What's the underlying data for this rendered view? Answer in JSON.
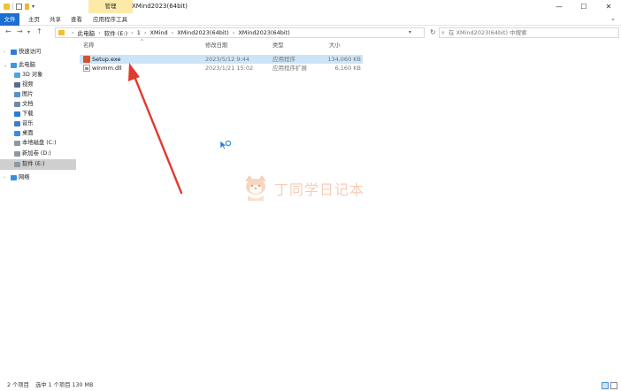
{
  "window": {
    "title": "XMind2023(64bit)",
    "context_tab": "管理",
    "controls": {
      "minimize": "—",
      "maximize": "☐",
      "close": "✕"
    }
  },
  "ribbon": {
    "tabs": [
      "文件",
      "主页",
      "共享",
      "查看",
      "应用程序工具"
    ],
    "collapse_glyph": "⌄"
  },
  "address": {
    "crumbs": [
      "此电脑",
      "软件 (E:)",
      "1",
      "XMind",
      "XMind2023(64bit)",
      "XMind2023(64bit)"
    ],
    "search_placeholder": "在 XMind2023(64bit) 中搜索"
  },
  "sidebar": {
    "items": [
      {
        "label": "快速访问",
        "icon": "star-icon",
        "color": "#2f7cd6"
      },
      {
        "label": "此电脑",
        "icon": "computer-icon",
        "color": "#3a9ad9"
      },
      {
        "label": "3D 对象",
        "icon": "cube-icon",
        "color": "#4aa8e0"
      },
      {
        "label": "视频",
        "icon": "video-icon",
        "color": "#5b6d85"
      },
      {
        "label": "图片",
        "icon": "picture-icon",
        "color": "#5a8fc7"
      },
      {
        "label": "文档",
        "icon": "document-icon",
        "color": "#6d88a8"
      },
      {
        "label": "下载",
        "icon": "download-icon",
        "color": "#2a7bd4"
      },
      {
        "label": "音乐",
        "icon": "music-icon",
        "color": "#3c7fd0"
      },
      {
        "label": "桌面",
        "icon": "desktop-icon",
        "color": "#3a8dde"
      },
      {
        "label": "本地磁盘 (C:)",
        "icon": "drive-icon",
        "color": "#8c98a4"
      },
      {
        "label": "新加卷 (D:)",
        "icon": "drive-icon",
        "color": "#8c98a4"
      },
      {
        "label": "软件 (E:)",
        "icon": "drive-icon",
        "color": "#8c98a4"
      },
      {
        "label": "网络",
        "icon": "network-icon",
        "color": "#3a8dde"
      }
    ]
  },
  "columns": {
    "name": "名称",
    "date": "修改日期",
    "type": "类型",
    "size": "大小"
  },
  "files": [
    {
      "name": "Setup.exe",
      "date": "2023/5/12 9:44",
      "type": "应用程序",
      "size": "134,060 KB",
      "icon": "exe-icon",
      "selected": true
    },
    {
      "name": "winmm.dll",
      "date": "2023/1/21 15:02",
      "type": "应用程序扩展",
      "size": "6,160 KB",
      "icon": "dll-icon",
      "selected": false
    }
  ],
  "watermark": {
    "text": "丁同学日记本"
  },
  "status": {
    "count": "2 个项目",
    "selection": "选中 1 个项目 130 MB"
  },
  "colors": {
    "accent": "#1a6fd0",
    "selection": "#cce4f7",
    "arrow": "#e03a2f"
  }
}
